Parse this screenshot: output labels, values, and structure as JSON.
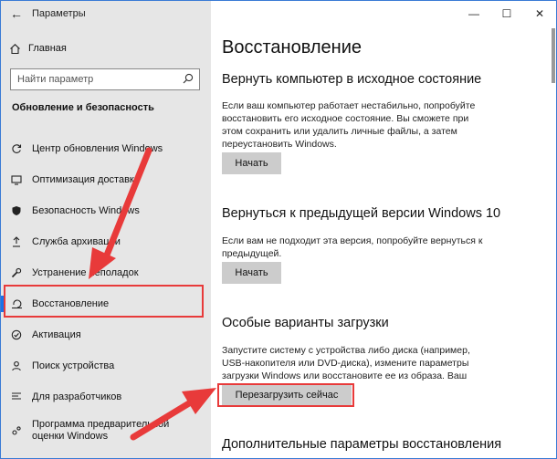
{
  "window": {
    "title": "Параметры",
    "controls": {
      "minimize": "—",
      "maximize": "☐",
      "close": "✕"
    }
  },
  "sidebar": {
    "home_label": "Главная",
    "search": {
      "placeholder": "Найти параметр"
    },
    "section_title": "Обновление и безопасность",
    "items": [
      {
        "label": "Центр обновления Windows",
        "icon": "refresh-icon"
      },
      {
        "label": "Оптимизация доставки",
        "icon": "delivery-icon"
      },
      {
        "label": "Безопасность Windows",
        "icon": "shield-icon"
      },
      {
        "label": "Служба архивации",
        "icon": "backup-icon"
      },
      {
        "label": "Устранение неполадок",
        "icon": "wrench-icon"
      },
      {
        "label": "Восстановление",
        "icon": "recovery-icon"
      },
      {
        "label": "Активация",
        "icon": "check-circle-icon"
      },
      {
        "label": "Поиск устройства",
        "icon": "person-icon"
      },
      {
        "label": "Для разработчиков",
        "icon": "developer-icon"
      },
      {
        "label": "Программа предварительной оценки Windows",
        "icon": "insider-icon"
      }
    ],
    "selected_index": 5
  },
  "main": {
    "title": "Восстановление",
    "reset": {
      "heading": "Вернуть компьютер в исходное состояние",
      "description": "Если ваш компьютер работает нестабильно, попробуйте восстановить его исходное состояние. Вы сможете при этом сохранить или удалить личные файлы, а затем переустановить Windows.",
      "button": "Начать"
    },
    "rollback": {
      "heading": "Вернуться к предыдущей версии Windows 10",
      "description": "Если вам не подходит эта версия, попробуйте вернуться к предыдущей.",
      "button": "Начать"
    },
    "advanced": {
      "heading": "Особые варианты загрузки",
      "description": "Запустите систему с устройства либо диска (например, USB-накопителя или DVD-диска), измените параметры загрузки Windows или восстановите ее из образа. Ваш компьютер перезагрузится.",
      "button": "Перезагрузить сейчас"
    },
    "more": {
      "heading": "Дополнительные параметры восстановления"
    }
  },
  "colors": {
    "accent": "#1a73e8",
    "annotation": "#e83a3a",
    "sidebar_bg": "#e6e6e6",
    "button_bg": "#cccccc"
  }
}
